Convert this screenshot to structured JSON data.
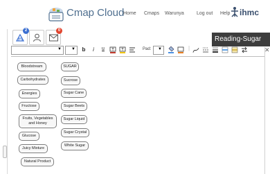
{
  "header": {
    "brand": "Cmap Cloud",
    "nav": [
      "Home",
      "Cmaps",
      "Warunya",
      "Log out",
      "Help"
    ],
    "partner_logo": "ihmc"
  },
  "tabs": [
    {
      "icon": "concept-map-icon",
      "badge": "2",
      "badge_color": "#3b6fd1"
    },
    {
      "icon": "user-icon",
      "badge": "",
      "badge_color": ""
    },
    {
      "icon": "mail-icon",
      "badge": "0",
      "badge_color": "#e2452f"
    }
  ],
  "tooltip": {
    "text": "Reading-Sugar"
  },
  "toolbar": {
    "font_select_value": "",
    "size_select_value": "",
    "bold": "b",
    "italic": "i",
    "underline": "u",
    "pad_label": "Pad:",
    "pad_value": ""
  },
  "concepts": {
    "left": [
      "Bloodstream",
      "Carbohydrates",
      "Energies",
      "Fructose",
      "Fruits, Vegetables and Honey",
      "Glucose",
      "Juicy Mixture",
      "Natural Product"
    ],
    "right": [
      "SUGAR",
      "Sucrose",
      "Sugar Cane",
      "Sugar Beets",
      "Sugar Liquid",
      "Sugar Crystal",
      "White Sugar"
    ]
  },
  "colors": {
    "brand_text": "#4f6f8f",
    "tooltip_bg": "#3d3d3d",
    "node_border": "#7b7b7b"
  }
}
